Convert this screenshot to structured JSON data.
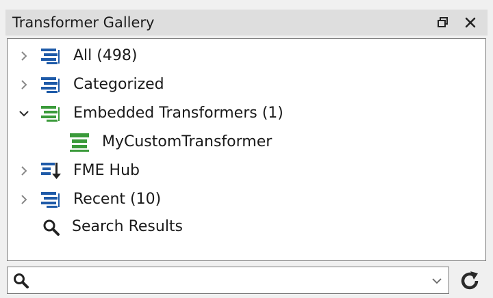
{
  "panel": {
    "title": "Transformer Gallery",
    "float_icon": "float-window-icon",
    "close_icon": "close-icon"
  },
  "tree": {
    "items": [
      {
        "label": "All (498)",
        "expanded": false,
        "icon": "transformer-list-icon"
      },
      {
        "label": "Categorized",
        "expanded": false,
        "icon": "transformer-list-icon"
      },
      {
        "label": "Embedded Transformers (1)",
        "expanded": true,
        "icon": "transformer-list-green-icon"
      },
      {
        "label": "MyCustomTransformer",
        "child": true,
        "icon": "custom-transformer-icon"
      },
      {
        "label": "FME Hub",
        "expanded": false,
        "icon": "fme-hub-download-icon"
      },
      {
        "label": "Recent (10)",
        "expanded": false,
        "icon": "transformer-list-icon"
      },
      {
        "label": "Search Results",
        "icon": "search-icon"
      }
    ]
  },
  "search": {
    "value": "",
    "placeholder": ""
  },
  "colors": {
    "blue_icon": "#1e5aa8",
    "green_icon": "#3a9a3a",
    "text": "#1a1a1a"
  }
}
